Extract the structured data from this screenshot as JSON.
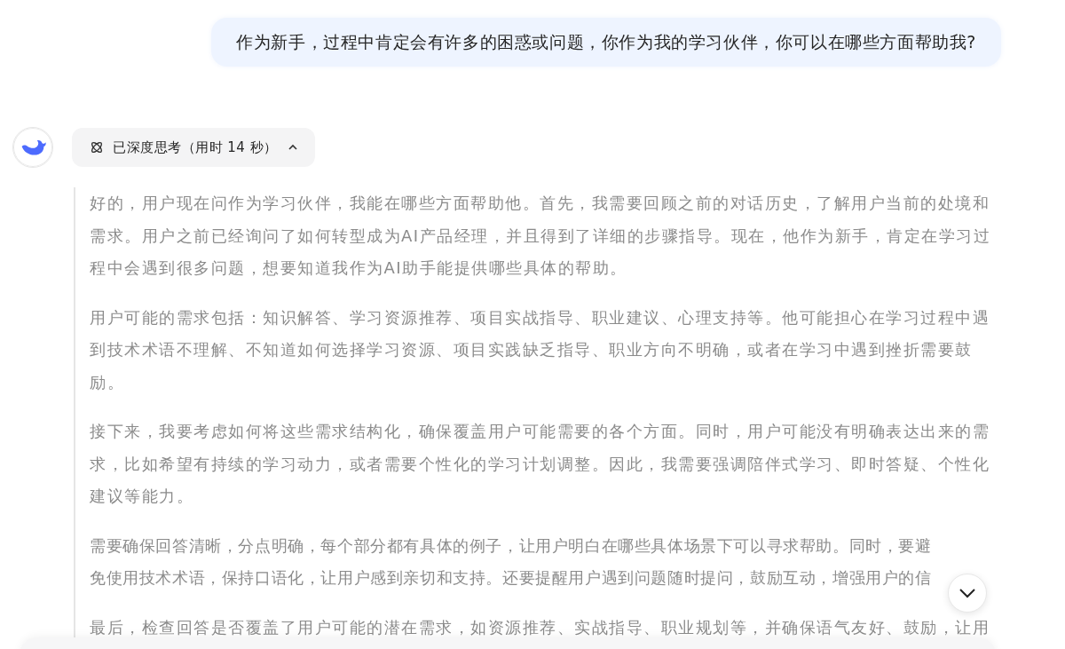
{
  "user_message": "作为新手，过程中肯定会有许多的困惑或问题，你作为我的学习伙伴，你可以在哪些方面帮助我?",
  "thinking": {
    "label": "已深度思考（用时 14 秒）",
    "expanded": true,
    "paragraphs": [
      "好的，用户现在问作为学习伙伴，我能在哪些方面帮助他。首先，我需要回顾之前的对话历史，了解用户当前的处境和需求。用户之前已经询问了如何转型成为AI产品经理，并且得到了详细的步骤指导。现在，他作为新手，肯定在学习过程中会遇到很多问题，想要知道我作为AI助手能提供哪些具体的帮助。",
      "用户可能的需求包括：知识解答、学习资源推荐、项目实战指导、职业建议、心理支持等。他可能担心在学习过程中遇到技术术语不理解、不知道如何选择学习资源、项目实践缺乏指导、职业方向不明确，或者在学习中遇到挫折需要鼓励。",
      "接下来，我要考虑如何将这些需求结构化，确保覆盖用户可能需要的各个方面。同时，用户可能没有明确表达出来的需求，比如希望有持续的学习动力，或者需要个性化的学习计划调整。因此，我需要强调陪伴式学习、即时答疑、个性化建议等能力。",
      "需要确保回答清晰，分点明确，每个部分都有具体的例子，让用户明白在哪些具体场景下可以寻求帮助。同时，要避免使用技术术语，保持口语化，让用户感到亲切和支持。还要提醒用户遇到问题随时提问，鼓励互动，增强用户的信",
      "最后，检查回答是否覆盖了用户可能的潜在需求，如资源推荐、实战指导、职业规划等，并确保语气友好、鼓励，让用"
    ]
  }
}
